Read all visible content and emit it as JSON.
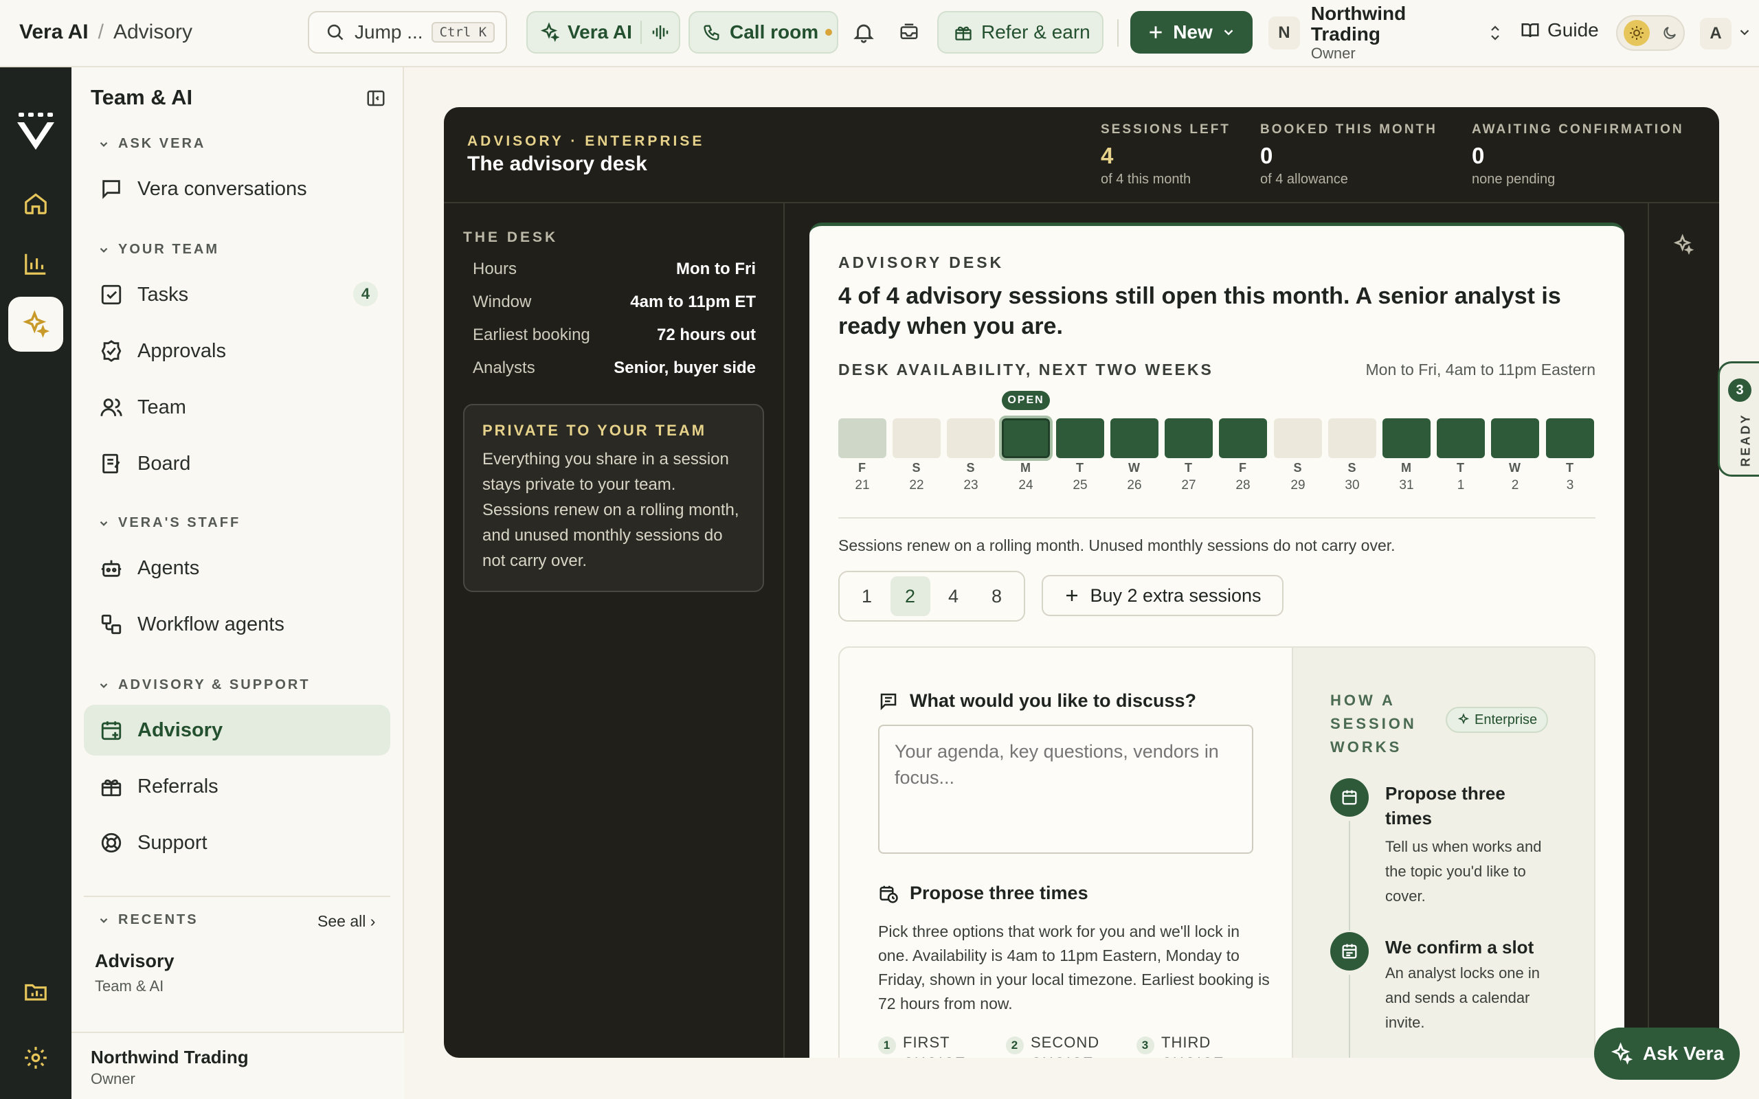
{
  "topbar": {
    "brand": "Vera AI",
    "crumb": "Advisory",
    "search_label": "Jump ...",
    "search_kbd": "Ctrl K",
    "vera_ai": "Vera AI",
    "call_room": "Call room",
    "refer": "Refer & earn",
    "new": "New",
    "org_initial": "N",
    "org_name": "Northwind Trading",
    "org_role": "Owner",
    "guide": "Guide",
    "user_initial": "A"
  },
  "sidebar": {
    "title": "Team & AI",
    "sections": [
      {
        "label": "ASK VERA"
      },
      {
        "label": "YOUR TEAM"
      },
      {
        "label": "VERA'S STAFF"
      },
      {
        "label": "ADVISORY & SUPPORT"
      },
      {
        "label": "RECENTS"
      }
    ],
    "items": {
      "conversations": "Vera conversations",
      "tasks": "Tasks",
      "tasks_count": "4",
      "approvals": "Approvals",
      "team": "Team",
      "board": "Board",
      "agents": "Agents",
      "workflow_agents": "Workflow agents",
      "advisory": "Advisory",
      "referrals": "Referrals",
      "support": "Support"
    },
    "see_all": "See all ›",
    "recent": {
      "title": "Advisory",
      "sub": "Team & AI"
    },
    "footer": {
      "name": "Northwind Trading",
      "role": "Owner"
    }
  },
  "main": {
    "label": "ADVISORY · ENTERPRISE",
    "title": "The advisory desk",
    "stats": [
      {
        "label": "SESSIONS LEFT",
        "value": "4",
        "sub": "of 4 this month"
      },
      {
        "label": "BOOKED THIS MONTH",
        "value": "0",
        "sub": "of 4 allowance"
      },
      {
        "label": "AWAITING CONFIRMATION",
        "value": "0",
        "sub": "none pending"
      }
    ],
    "desk": {
      "heading": "THE DESK",
      "rows": [
        {
          "k": "Hours",
          "v": "Mon to Fri"
        },
        {
          "k": "Window",
          "v": "4am to 11pm ET"
        },
        {
          "k": "Earliest booking",
          "v": "72 hours out"
        },
        {
          "k": "Analysts",
          "v": "Senior, buyer side"
        }
      ]
    },
    "private": {
      "heading": "PRIVATE TO YOUR TEAM",
      "text": "Everything you share in a session stays private to your team. Sessions renew on a rolling month, and unused monthly sessions do not carry over."
    },
    "card": {
      "label": "ADVISORY DESK",
      "title": "4 of 4 advisory sessions still open this month. A senior analyst is ready when you are.",
      "avail_heading": "DESK AVAILABILITY, NEXT TWO WEEKS",
      "avail_hours": "Mon to Fri, 4am to 11pm Eastern",
      "open_tag": "OPEN",
      "days": [
        {
          "l": "F",
          "n": "21",
          "s": "past"
        },
        {
          "l": "S",
          "n": "22",
          "s": "weekend"
        },
        {
          "l": "S",
          "n": "23",
          "s": "weekend"
        },
        {
          "l": "M",
          "n": "24",
          "s": "open-selected"
        },
        {
          "l": "T",
          "n": "25",
          "s": "open"
        },
        {
          "l": "W",
          "n": "26",
          "s": "open"
        },
        {
          "l": "T",
          "n": "27",
          "s": "open"
        },
        {
          "l": "F",
          "n": "28",
          "s": "open"
        },
        {
          "l": "S",
          "n": "29",
          "s": "weekend"
        },
        {
          "l": "S",
          "n": "30",
          "s": "weekend"
        },
        {
          "l": "M",
          "n": "31",
          "s": "open"
        },
        {
          "l": "T",
          "n": "1",
          "s": "open"
        },
        {
          "l": "W",
          "n": "2",
          "s": "open"
        },
        {
          "l": "T",
          "n": "3",
          "s": "open"
        }
      ],
      "renew_text": "Sessions renew on a rolling month. Unused monthly sessions do not carry over.",
      "qty_options": [
        "1",
        "2",
        "4",
        "8"
      ],
      "qty_selected": "2",
      "buy_label": "Buy 2 extra sessions",
      "discuss_heading": "What would you like to discuss?",
      "discuss_placeholder": "Your agenda, key questions, vendors in focus...",
      "propose_heading": "Propose three times",
      "propose_text": "Pick three options that work for you and we'll lock in one. Availability is 4am to 11pm Eastern, Monday to Friday, shown in your local timezone. Earliest booking is 72 hours from now.",
      "choices": [
        {
          "n": "1",
          "label": "FIRST CHOICE"
        },
        {
          "n": "2",
          "label": "SECOND CHOICE"
        },
        {
          "n": "3",
          "label": "THIRD CHOICE"
        }
      ],
      "how_heading": "HOW A SESSION WORKS",
      "how_badge": "Enterprise",
      "steps": [
        {
          "title": "Propose three times",
          "desc": "Tell us when works and the topic you'd like to cover."
        },
        {
          "title": "We confirm a slot",
          "desc": "An analyst locks one in and sends a calendar invite."
        }
      ]
    }
  },
  "ready_tab": {
    "count": "3",
    "label": "READY"
  },
  "ask_vera": "Ask Vera",
  "colors": {
    "accent": "#2e5a3a",
    "gold": "#e6d28a",
    "dark": "#201f1a",
    "cream": "#faf8f2"
  }
}
